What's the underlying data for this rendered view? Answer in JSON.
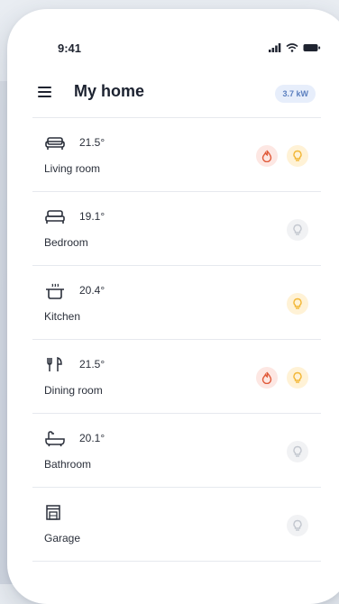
{
  "status_bar": {
    "time": "9:41"
  },
  "app_bar": {
    "title": "My home",
    "power_badge": "3.7 kW"
  },
  "rooms": [
    {
      "name": "Living room",
      "temp": "21.5°",
      "icon": "sofa-icon",
      "heating": true,
      "light_on": true
    },
    {
      "name": "Bedroom",
      "temp": "19.1°",
      "icon": "bed-icon",
      "heating": false,
      "light_on": false
    },
    {
      "name": "Kitchen",
      "temp": "20.4°",
      "icon": "pot-icon",
      "heating": false,
      "light_on": true
    },
    {
      "name": "Dining room",
      "temp": "21.5°",
      "icon": "cutlery-icon",
      "heating": true,
      "light_on": true
    },
    {
      "name": "Bathroom",
      "temp": "20.1°",
      "icon": "bathtub-icon",
      "heating": false,
      "light_on": false
    },
    {
      "name": "Garage",
      "temp": "",
      "icon": "garage-icon",
      "heating": false,
      "light_on": false
    }
  ],
  "colors": {
    "heating_active": "#e05a3a",
    "light_active": "#f2b634",
    "inactive": "#c3c7cf",
    "badge_text": "#5b7fbf"
  }
}
